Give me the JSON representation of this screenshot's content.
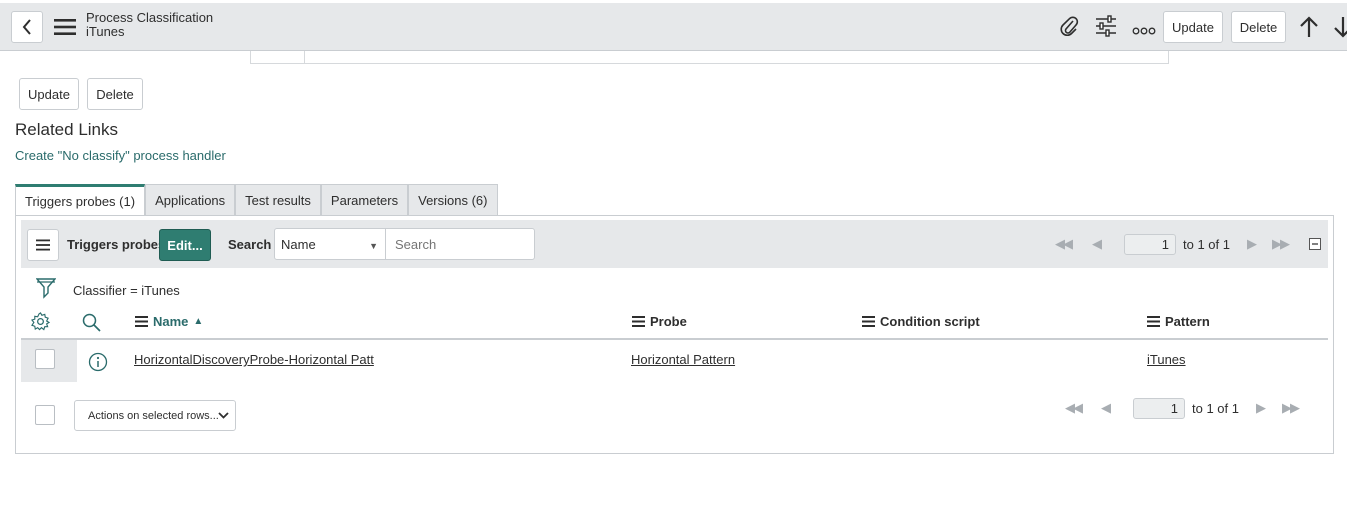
{
  "header": {
    "title": "Process Classification",
    "subtitle": "iTunes",
    "update_label": "Update",
    "delete_label": "Delete"
  },
  "form_buttons": {
    "update_label": "Update",
    "delete_label": "Delete"
  },
  "related": {
    "title": "Related Links",
    "link": "Create \"No classify\" process handler"
  },
  "tabs": [
    {
      "label": "Triggers probes (1)",
      "active": true
    },
    {
      "label": "Applications"
    },
    {
      "label": "Test results"
    },
    {
      "label": "Parameters"
    },
    {
      "label": "Versions (6)"
    }
  ],
  "list": {
    "title": "Triggers probes",
    "edit_label": "Edit...",
    "search_label": "Search",
    "search_field": "Name",
    "search_placeholder": "Search",
    "page": "1",
    "page_text": "to 1 of 1",
    "filter": "Classifier = iTunes",
    "columns": [
      "Name",
      "Probe",
      "Condition script",
      "Pattern"
    ],
    "rows": [
      {
        "name": "HorizontalDiscoveryProbe-Horizontal Patt",
        "probe": "Horizontal Pattern",
        "condition": "",
        "pattern": "iTunes"
      }
    ],
    "actions_label": "Actions on selected rows..."
  }
}
